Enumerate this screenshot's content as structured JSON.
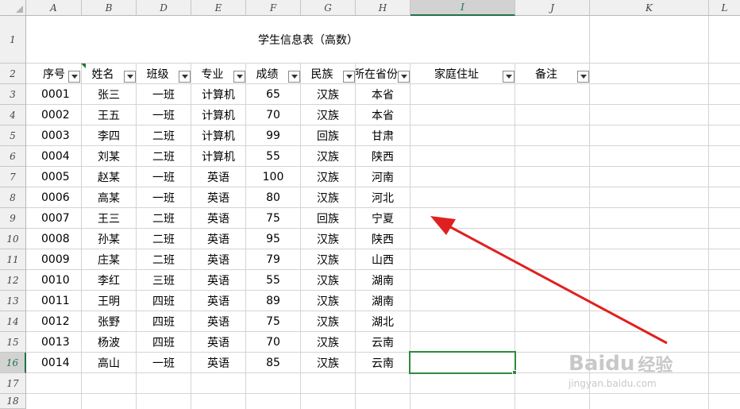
{
  "columns": [
    "A",
    "B",
    "D",
    "E",
    "F",
    "G",
    "H",
    "I",
    "J",
    "K",
    "L"
  ],
  "row_numbers": [
    "1",
    "2",
    "3",
    "4",
    "5",
    "6",
    "7",
    "8",
    "9",
    "10",
    "11",
    "12",
    "13",
    "14",
    "15",
    "16",
    "17",
    "18"
  ],
  "sheet": {
    "title": "学生信息表（高数）",
    "headers": [
      "序号",
      "姓名",
      "班级",
      "专业",
      "成绩",
      "民族",
      "所在省份",
      "家庭住址",
      "备注"
    ],
    "rows": [
      [
        "0001",
        "张三",
        "一班",
        "计算机",
        "65",
        "汉族",
        "本省"
      ],
      [
        "0002",
        "王五",
        "一班",
        "计算机",
        "70",
        "汉族",
        "本省"
      ],
      [
        "0003",
        "李四",
        "二班",
        "计算机",
        "99",
        "回族",
        "甘肃"
      ],
      [
        "0004",
        "刘某",
        "二班",
        "计算机",
        "55",
        "汉族",
        "陕西"
      ],
      [
        "0005",
        "赵某",
        "一班",
        "英语",
        "100",
        "汉族",
        "河南"
      ],
      [
        "0006",
        "高某",
        "一班",
        "英语",
        "80",
        "汉族",
        "河北"
      ],
      [
        "0007",
        "王三",
        "二班",
        "英语",
        "75",
        "回族",
        "宁夏"
      ],
      [
        "0008",
        "孙某",
        "二班",
        "英语",
        "95",
        "汉族",
        "陕西"
      ],
      [
        "0009",
        "庄某",
        "二班",
        "英语",
        "79",
        "汉族",
        "山西"
      ],
      [
        "0010",
        "李红",
        "三班",
        "英语",
        "55",
        "汉族",
        "湖南"
      ],
      [
        "0011",
        "王明",
        "四班",
        "英语",
        "89",
        "汉族",
        "湖南"
      ],
      [
        "0012",
        "张野",
        "四班",
        "英语",
        "75",
        "汉族",
        "湖北"
      ],
      [
        "0013",
        "杨波",
        "四班",
        "英语",
        "70",
        "汉族",
        "云南"
      ],
      [
        "0014",
        "高山",
        "一班",
        "英语",
        "85",
        "汉族",
        "云南"
      ]
    ]
  },
  "selected_cell": {
    "column": "I",
    "row": "16"
  },
  "watermark": {
    "brand": "Baidu",
    "suffix": "经验",
    "url": "jingyan.baidu.com"
  },
  "colors": {
    "selection": "#2f8a3e",
    "arrow": "#e02020",
    "header_bg": "#f0f0f0",
    "grid": "#d4d4d4"
  }
}
